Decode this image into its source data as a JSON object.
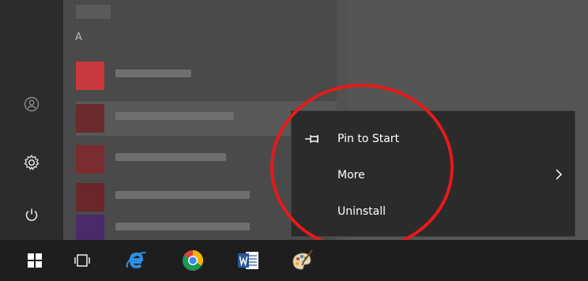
{
  "start_menu": {
    "section_letter": "A",
    "rail": [
      {
        "name": "user",
        "icon": "user-icon"
      },
      {
        "name": "settings",
        "icon": "gear-icon"
      },
      {
        "name": "power",
        "icon": "power-icon"
      }
    ]
  },
  "context_menu": {
    "items": [
      {
        "label": "Pin to Start",
        "icon": "pin-icon"
      },
      {
        "label": "More",
        "icon": "chevron-right-icon"
      },
      {
        "label": "Uninstall",
        "icon": ""
      }
    ]
  },
  "taskbar": {
    "items": [
      "windows-start-icon",
      "task-view-icon",
      "internet-explorer-icon",
      "chrome-icon",
      "word-icon",
      "paint-icon"
    ]
  },
  "colors": {
    "highlight_ring": "#e8191a",
    "menu_bg": "#2b2b2b",
    "taskbar_bg": "#1e1e1e"
  }
}
